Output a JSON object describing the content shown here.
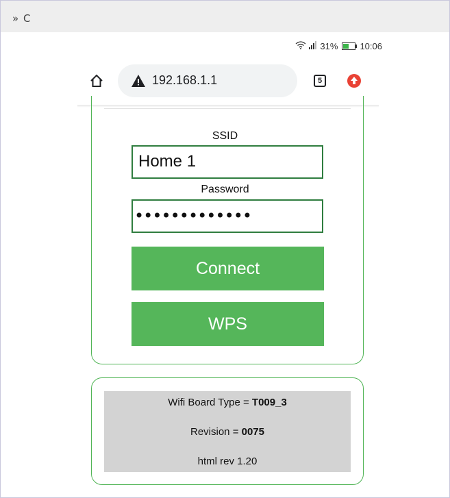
{
  "window": {
    "top_glyphs": "» C"
  },
  "status_bar": {
    "signal_percent": "31%",
    "time": "10:06"
  },
  "browser": {
    "url": "192.168.1.1",
    "tab_count": "5"
  },
  "form": {
    "ssid_label": "SSID",
    "ssid_value": "Home 1",
    "password_label": "Password",
    "password_value": "•••••••••••••",
    "connect_label": "Connect",
    "wps_label": "WPS"
  },
  "info": {
    "board_type_prefix": "Wifi Board Type = ",
    "board_type_value": "T009_3",
    "revision_prefix": "Revision = ",
    "revision_value": "0075",
    "html_rev": "html rev 1.20"
  },
  "colors": {
    "accent_green": "#55b65a",
    "field_border": "#2f7d3f",
    "info_bg": "#d3d3d3",
    "update_red": "#e94235"
  }
}
